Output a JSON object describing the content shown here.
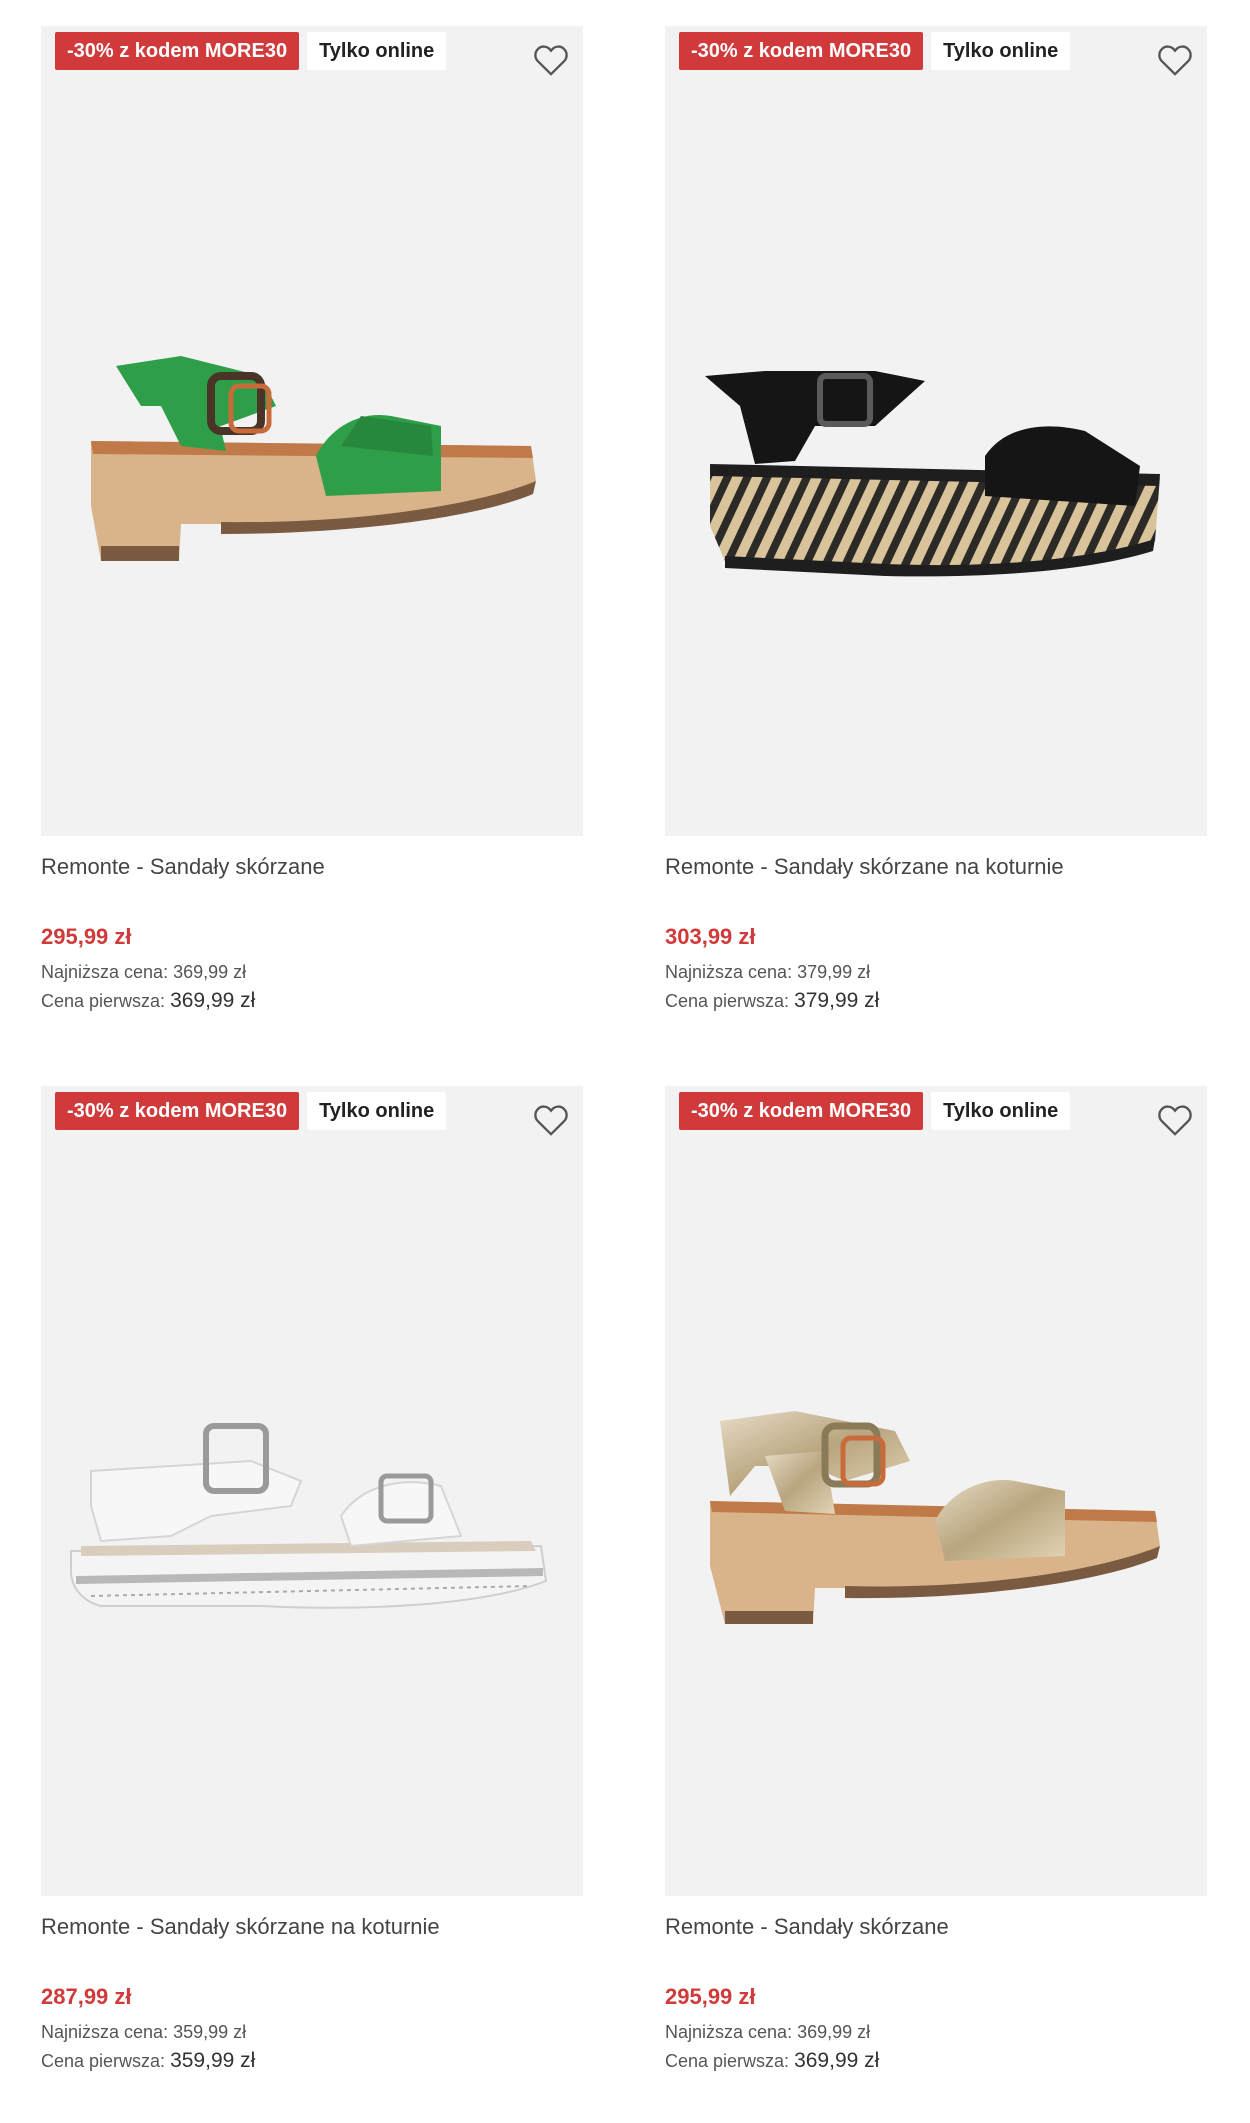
{
  "products": [
    {
      "promo_badge": "-30% z kodem MORE30",
      "online_badge": "Tylko online",
      "title": "Remonte - Sandały skórzane",
      "price": "295,99 zł",
      "lowest_label": "Najniższa cena:",
      "lowest_value": "369,99 zł",
      "first_label": "Cena pierwsza:",
      "first_value": "369,99 zł",
      "image": "green-leather-sandal-block-heel"
    },
    {
      "promo_badge": "-30% z kodem MORE30",
      "online_badge": "Tylko online",
      "title": "Remonte - Sandały skórzane na koturnie",
      "price": "303,99 zł",
      "lowest_label": "Najniższa cena:",
      "lowest_value": "379,99 zł",
      "first_label": "Cena pierwsza:",
      "first_value": "379,99 zł",
      "image": "black-suede-sandal-zebra-platform"
    },
    {
      "promo_badge": "-30% z kodem MORE30",
      "online_badge": "Tylko online",
      "title": "Remonte - Sandały skórzane na koturnie",
      "price": "287,99 zł",
      "lowest_label": "Najniższa cena:",
      "lowest_value": "359,99 zł",
      "first_label": "Cena pierwsza:",
      "first_value": "359,99 zł",
      "image": "white-leather-sandal-sneaker-sole"
    },
    {
      "promo_badge": "-30% z kodem MORE30",
      "online_badge": "Tylko online",
      "title": "Remonte - Sandały skórzane",
      "price": "295,99 zł",
      "lowest_label": "Najniższa cena:",
      "lowest_value": "369,99 zł",
      "first_label": "Cena pierwsza:",
      "first_value": "369,99 zł",
      "image": "gold-metallic-sandal-block-heel"
    }
  ],
  "colors": {
    "promo": "#d13a3a",
    "price": "#d13a3a",
    "image_bg": "#f2f2f2"
  },
  "icons": {
    "favorite": "heart-outline-icon"
  }
}
